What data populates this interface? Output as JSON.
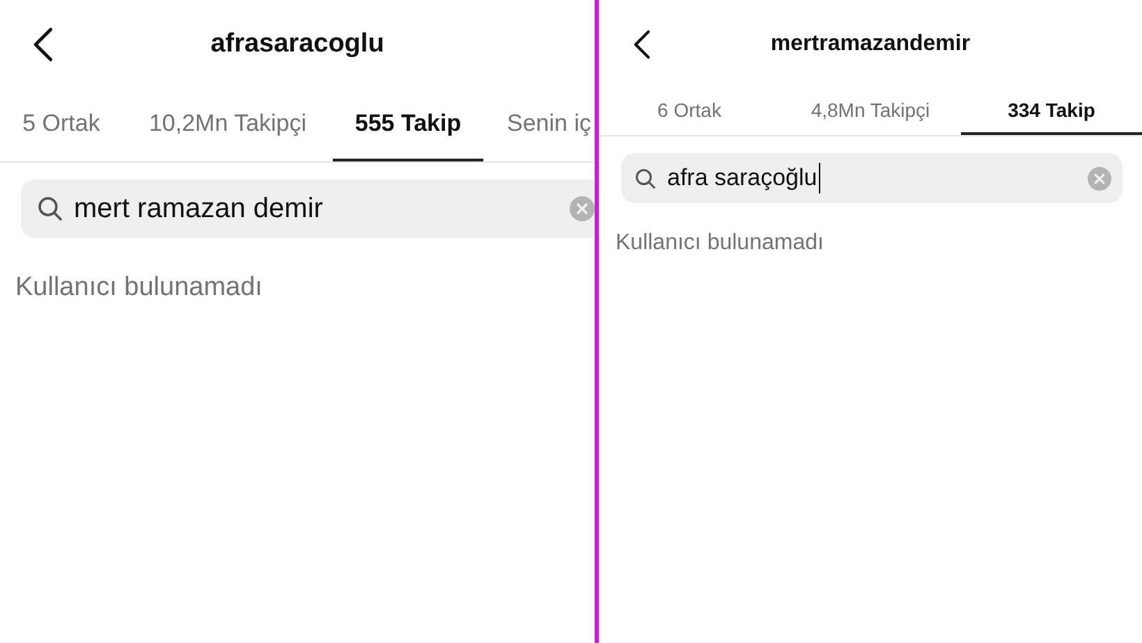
{
  "panels": [
    {
      "title": "afrasaracoglu",
      "tabs": [
        {
          "label": "5 Ortak",
          "selected": false
        },
        {
          "label": "10,2Mn Takipçi",
          "selected": false
        },
        {
          "label": "555 Takip",
          "selected": true
        },
        {
          "label": "Senin iç",
          "selected": false
        }
      ],
      "search": {
        "value": "mert ramazan demir",
        "focused": false
      },
      "message": "Kullanıcı bulunamadı"
    },
    {
      "title": "mertramazandemir",
      "tabs": [
        {
          "label": "6 Ortak",
          "selected": false
        },
        {
          "label": "4,8Mn Takipçi",
          "selected": false
        },
        {
          "label": "334 Takip",
          "selected": true
        }
      ],
      "search": {
        "value": "afra saraçoğlu",
        "focused": true
      },
      "message": "Kullanıcı bulunamadı"
    }
  ]
}
